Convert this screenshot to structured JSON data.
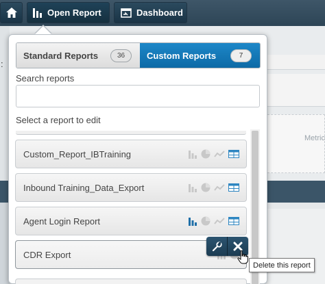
{
  "topbar": {
    "home_label": "",
    "open_report_label": "Open Report",
    "dashboard_label": "Dashboard"
  },
  "background": {
    "colon": ":",
    "metric_label": "Metric"
  },
  "popup": {
    "tabs": [
      {
        "label": "Standard Reports",
        "count": "36",
        "active": false
      },
      {
        "label": "Custom Reports",
        "count": "7",
        "active": true
      }
    ],
    "search_label": "Search reports",
    "search_value": "",
    "select_label": "Select a report to edit",
    "reports": [
      {
        "name": "Custom_Report_IBTraining",
        "bar_active": false
      },
      {
        "name": "Inbound Training_Data_Export",
        "bar_active": false
      },
      {
        "name": "Agent Login Report",
        "bar_active": true
      },
      {
        "name": "CDR Export",
        "bar_active": false
      }
    ],
    "tooltip": "Delete this report"
  },
  "colors": {
    "accent": "#1d87c8",
    "active_icon": "#1f6fa8",
    "inactive_icon": "#c8c8c8",
    "table_icon": "#2e86c1"
  },
  "icons": [
    "home-icon",
    "bar-chart-icon",
    "dashboard-icon",
    "pie-chart-icon",
    "line-chart-icon",
    "table-icon",
    "wrench-icon",
    "close-icon",
    "hand-cursor-icon"
  ]
}
